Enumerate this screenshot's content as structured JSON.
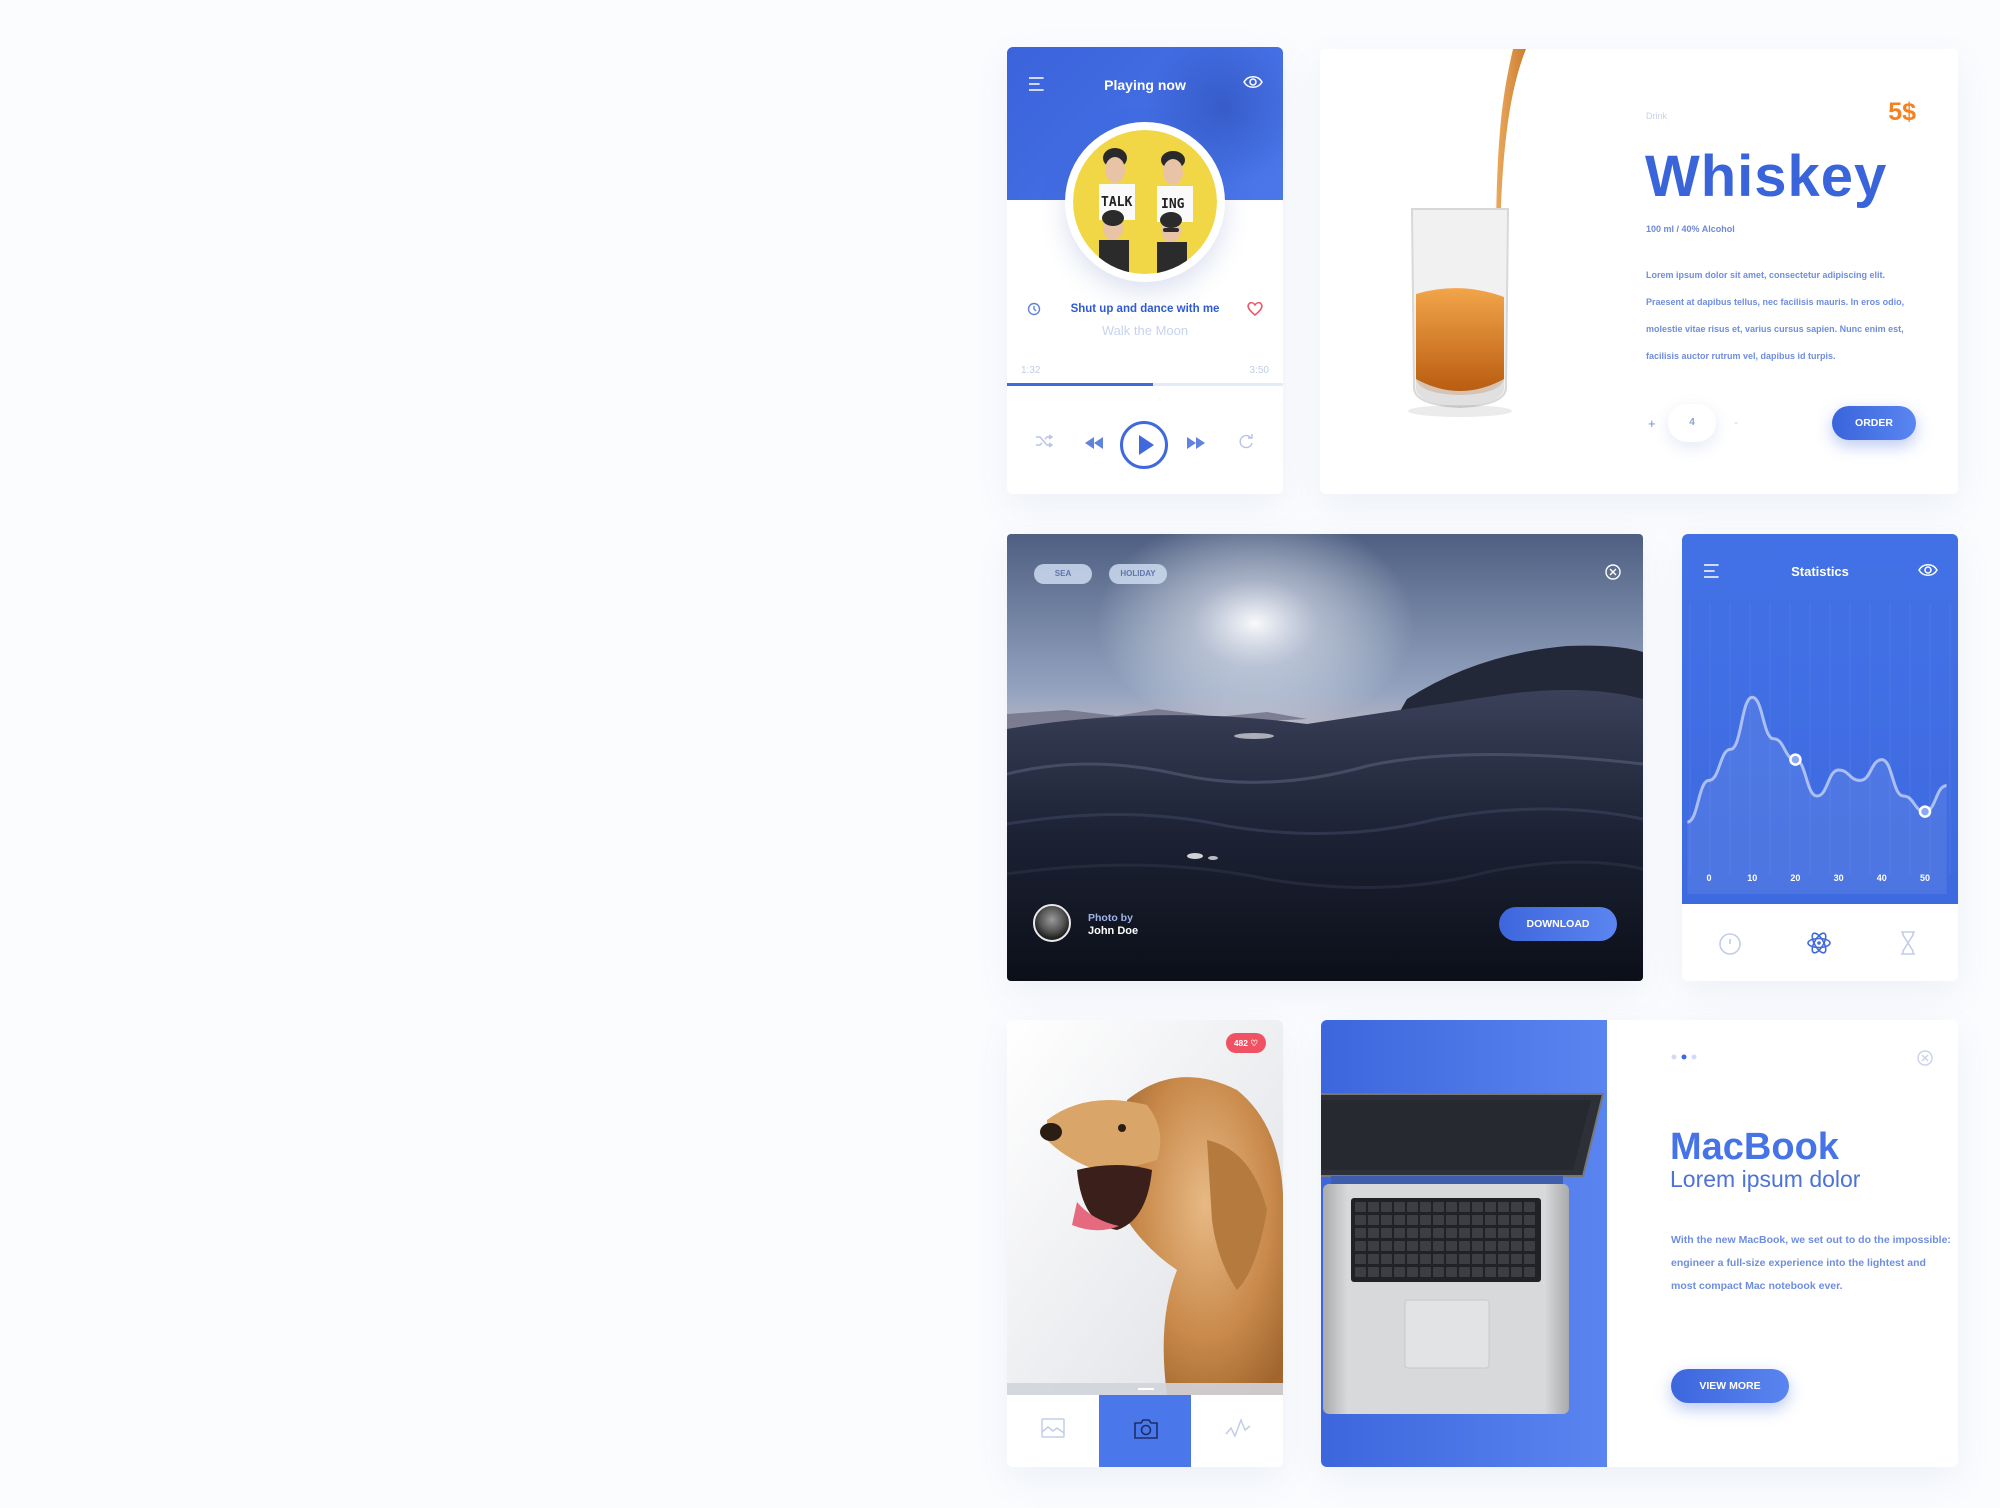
{
  "colors": {
    "accent": "#3f69dd",
    "accent_light": "#5a86f2",
    "price": "#f58220",
    "like": "#f05263"
  },
  "player": {
    "title": "Playing now",
    "song": "Shut up and dance with me",
    "artist": "Walk the Moon",
    "time_elapsed": "1:32",
    "time_total": "3:50",
    "progress": 0.53,
    "icons": [
      "menu-icon",
      "eye-icon",
      "timer-icon",
      "heart-icon",
      "shuffle-icon",
      "prev-icon",
      "play-icon",
      "next-icon",
      "repeat-icon"
    ]
  },
  "whiskey": {
    "category": "Drink",
    "price": "5$",
    "name": "Whiskey",
    "spec": "100 ml / 40% Alcohol",
    "description": "Lorem ipsum dolor sit amet, consectetur adipiscing elit. Praesent at dapibus tellus, nec facilisis mauris. In eros odio, molestie vitae risus et, varius cursus sapien. Nunc enim est, facilisis auctor rutrum vel, dapibus id turpis.",
    "plus": "+",
    "quantity": "4",
    "minus": "-",
    "order_label": "ORDER"
  },
  "sea": {
    "tags": [
      "SEA",
      "HOLIDAY"
    ],
    "byline": "Photo by",
    "author": "John Doe",
    "download_label": "DOWNLOAD"
  },
  "stats": {
    "title": "Statistics",
    "tabs": [
      "clock-icon",
      "atom-icon",
      "hourglass-icon"
    ]
  },
  "chart_data": {
    "type": "line",
    "title": "",
    "x_ticks": [
      "0",
      "10",
      "20",
      "30",
      "40",
      "50"
    ],
    "x": [
      -5,
      0,
      5,
      10,
      15,
      20,
      25,
      30,
      35,
      40,
      45,
      50,
      55
    ],
    "y": [
      20,
      36,
      48,
      68,
      52,
      44,
      30,
      40,
      36,
      44,
      30,
      24,
      34
    ],
    "highlight_points": [
      {
        "x": 20,
        "y": 44
      },
      {
        "x": 50,
        "y": 24
      }
    ],
    "ylim": [
      0,
      100
    ],
    "grid": true
  },
  "dog": {
    "likes": "482",
    "tabs": [
      "image-icon",
      "camera-icon",
      "activity-icon"
    ],
    "active_tab": 1
  },
  "mac": {
    "title": "MacBook",
    "subtitle": "Lorem ipsum dolor",
    "description": "With the new MacBook, we set out to do the impossible: engineer a full-size experience into the lightest and most compact Mac notebook ever.",
    "button_label": "VIEW MORE",
    "active_dot": 1
  }
}
